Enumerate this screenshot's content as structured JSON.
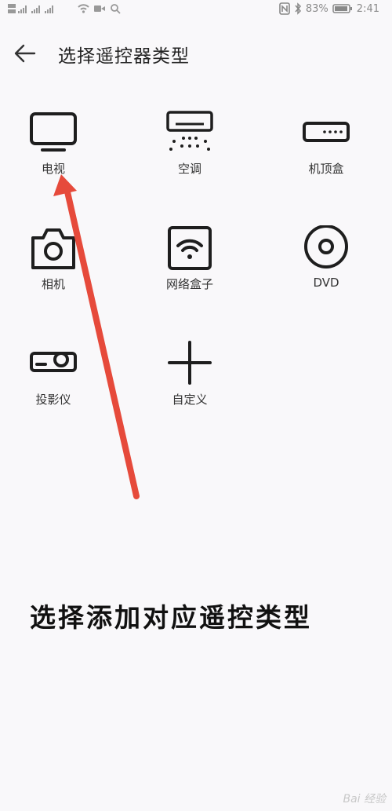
{
  "status_bar": {
    "battery_percent": "83%",
    "time": "2:41"
  },
  "header": {
    "title": "选择遥控器类型"
  },
  "devices": [
    {
      "id": "tv",
      "label": "电视",
      "icon": "tv-icon"
    },
    {
      "id": "ac",
      "label": "空调",
      "icon": "air-conditioner-icon"
    },
    {
      "id": "stb",
      "label": "机顶盒",
      "icon": "set-top-box-icon"
    },
    {
      "id": "camera",
      "label": "相机",
      "icon": "camera-icon"
    },
    {
      "id": "netbox",
      "label": "网络盒子",
      "icon": "network-box-icon"
    },
    {
      "id": "dvd",
      "label": "DVD",
      "icon": "dvd-icon"
    },
    {
      "id": "projector",
      "label": "投影仪",
      "icon": "projector-icon"
    },
    {
      "id": "custom",
      "label": "自定义",
      "icon": "plus-icon"
    }
  ],
  "annotation": {
    "caption": "选择添加对应遥控类型",
    "arrow_color": "#e64a3b"
  },
  "watermark": "Bai 经验"
}
